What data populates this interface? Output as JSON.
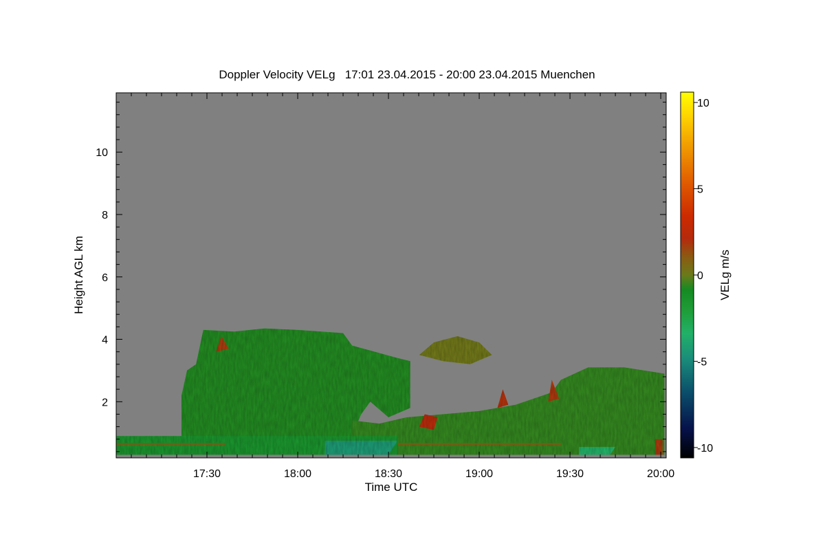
{
  "chart_data": {
    "type": "heatmap",
    "title": "Doppler Velocity VELg   17:01 23.04.2015 - 20:00 23.04.2015 Muenchen",
    "xlabel": "Time UTC",
    "ylabel": "Height AGL km",
    "colorbar_label": "VELg m/s",
    "x_range_hours": [
      17.0,
      20.03
    ],
    "y_range_km": [
      0.2,
      11.9
    ],
    "x_ticks": [
      {
        "value": 17.5,
        "label": "17:30"
      },
      {
        "value": 18.0,
        "label": "18:00"
      },
      {
        "value": 18.5,
        "label": "18:30"
      },
      {
        "value": 19.0,
        "label": "19:00"
      },
      {
        "value": 19.5,
        "label": "19:30"
      },
      {
        "value": 20.0,
        "label": "20:00"
      }
    ],
    "y_ticks": [
      {
        "value": 2,
        "label": "2"
      },
      {
        "value": 4,
        "label": "4"
      },
      {
        "value": 6,
        "label": "6"
      },
      {
        "value": 8,
        "label": "8"
      },
      {
        "value": 10,
        "label": "10"
      }
    ],
    "colorbar_range": [
      -10.6,
      10.6
    ],
    "colorbar_ticks": [
      {
        "value": 10,
        "label": "10"
      },
      {
        "value": 5,
        "label": "5"
      },
      {
        "value": 0,
        "label": "0"
      },
      {
        "value": -5,
        "label": "-5"
      },
      {
        "value": -10,
        "label": "-10"
      }
    ],
    "colormap": [
      "#000000",
      "#06124a",
      "#0b4f6b",
      "#1a8c7a",
      "#22b067",
      "#1f9e3a",
      "#168a22",
      "#6b7a1a",
      "#8b5a12",
      "#b52a0c",
      "#cc2a00",
      "#e05a00",
      "#f09a00",
      "#ffd800",
      "#ffff00"
    ],
    "background_color": "#808080",
    "regions": [
      {
        "name": "main-cloud",
        "value": -1.3,
        "polygon": [
          [
            17.36,
            0.3
          ],
          [
            17.36,
            2.2
          ],
          [
            17.39,
            3.0
          ],
          [
            17.44,
            3.2
          ],
          [
            17.48,
            4.3
          ],
          [
            17.65,
            4.25
          ],
          [
            17.82,
            4.35
          ],
          [
            18.0,
            4.3
          ],
          [
            18.25,
            4.2
          ],
          [
            18.3,
            3.8
          ],
          [
            18.55,
            3.4
          ],
          [
            18.62,
            3.3
          ],
          [
            18.62,
            1.8
          ],
          [
            18.5,
            1.5
          ],
          [
            18.4,
            2.0
          ],
          [
            18.35,
            1.6
          ],
          [
            18.32,
            1.2
          ],
          [
            18.3,
            0.3
          ]
        ]
      },
      {
        "name": "gap-cloud",
        "value": -1.0,
        "polygon": [
          [
            18.3,
            0.3
          ],
          [
            18.3,
            1.4
          ],
          [
            18.45,
            1.3
          ],
          [
            18.6,
            1.5
          ],
          [
            18.8,
            1.6
          ],
          [
            19.0,
            1.7
          ],
          [
            19.2,
            1.9
          ],
          [
            19.4,
            2.3
          ],
          [
            19.45,
            2.7
          ],
          [
            19.6,
            3.1
          ],
          [
            19.8,
            3.1
          ],
          [
            20.02,
            2.9
          ],
          [
            20.02,
            0.3
          ]
        ]
      },
      {
        "name": "upper-cloud-patch",
        "value": 0.2,
        "polygon": [
          [
            18.67,
            3.5
          ],
          [
            18.75,
            3.9
          ],
          [
            18.88,
            4.1
          ],
          [
            19.0,
            3.9
          ],
          [
            19.07,
            3.5
          ],
          [
            18.95,
            3.2
          ],
          [
            18.8,
            3.3
          ]
        ]
      },
      {
        "name": "low-level-layer",
        "value": -2.2,
        "polygon": [
          [
            17.0,
            0.3
          ],
          [
            17.0,
            0.9
          ],
          [
            18.55,
            0.9
          ],
          [
            18.55,
            0.3
          ]
        ]
      },
      {
        "name": "downdraft-core",
        "value": -5.5,
        "polygon": [
          [
            18.15,
            0.3
          ],
          [
            18.15,
            0.75
          ],
          [
            18.55,
            0.75
          ],
          [
            18.5,
            0.3
          ]
        ]
      },
      {
        "name": "evening-downdraft",
        "value": -4.5,
        "polygon": [
          [
            19.55,
            0.3
          ],
          [
            19.55,
            0.55
          ],
          [
            19.75,
            0.55
          ],
          [
            19.72,
            0.3
          ]
        ]
      },
      {
        "name": "updraft-1",
        "value": 2.5,
        "polygon": [
          [
            17.55,
            3.6
          ],
          [
            17.58,
            4.1
          ],
          [
            17.62,
            3.7
          ]
        ]
      },
      {
        "name": "updraft-2",
        "value": 2.8,
        "polygon": [
          [
            19.1,
            1.8
          ],
          [
            19.13,
            2.4
          ],
          [
            19.16,
            1.9
          ]
        ]
      },
      {
        "name": "updraft-3",
        "value": 2.6,
        "polygon": [
          [
            19.38,
            2.0
          ],
          [
            19.4,
            2.7
          ],
          [
            19.44,
            2.1
          ]
        ]
      },
      {
        "name": "updraft-4",
        "value": 3.0,
        "polygon": [
          [
            18.67,
            1.2
          ],
          [
            18.7,
            1.6
          ],
          [
            18.77,
            1.5
          ],
          [
            18.75,
            1.1
          ]
        ]
      },
      {
        "name": "updraft-5",
        "value": 2.5,
        "polygon": [
          [
            19.97,
            0.3
          ],
          [
            19.97,
            0.8
          ],
          [
            20.01,
            0.8
          ],
          [
            20.01,
            0.3
          ]
        ]
      }
    ],
    "line_features": [
      {
        "name": "surface-echo-line",
        "value": 2.0,
        "x": [
          17.0,
          17.6
        ],
        "y": 0.65
      },
      {
        "name": "surface-echo-line-2",
        "value": 2.0,
        "x": [
          18.55,
          19.45
        ],
        "y": 0.65
      }
    ],
    "grid": false
  }
}
